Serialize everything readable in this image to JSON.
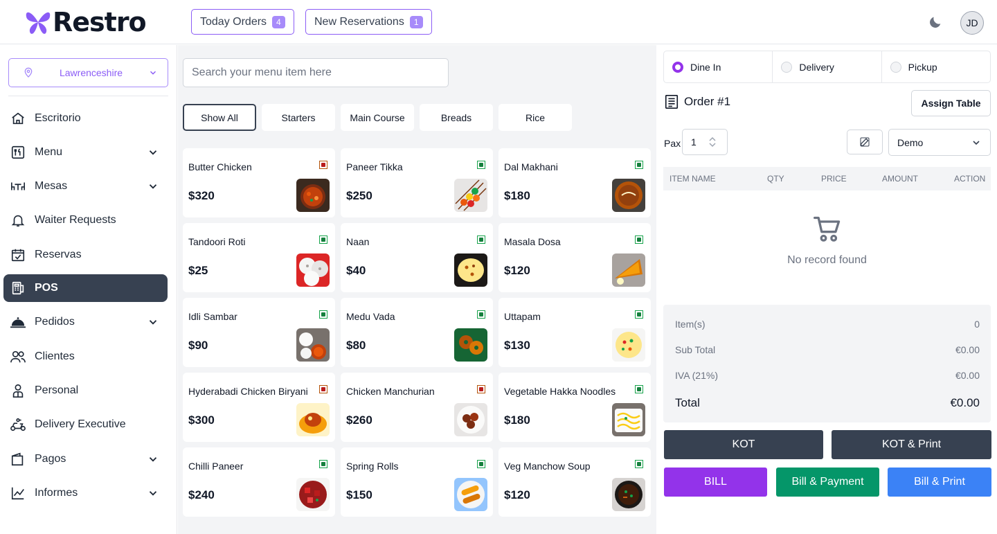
{
  "brand": {
    "name": "Restro",
    "color": "#8b5cf6"
  },
  "header": {
    "today_orders": {
      "label": "Today Orders",
      "count": "4"
    },
    "new_reservations": {
      "label": "New Reservations",
      "count": "1"
    },
    "theme_icon": "moon-icon",
    "avatar_initials": "JD"
  },
  "sidebar": {
    "branch": "Lawrenceshire",
    "items": [
      {
        "label": "Escritorio",
        "icon": "home-icon",
        "expandable": false
      },
      {
        "label": "Menu",
        "icon": "menu-book-icon",
        "expandable": true
      },
      {
        "label": "Mesas",
        "icon": "table-icon",
        "expandable": true
      },
      {
        "label": "Waiter Requests",
        "icon": "bell-icon",
        "expandable": false
      },
      {
        "label": "Reservas",
        "icon": "calendar-check-icon",
        "expandable": false
      },
      {
        "label": "POS",
        "icon": "pos-terminal-icon",
        "expandable": false,
        "active": true
      },
      {
        "label": "Pedidos",
        "icon": "cloche-icon",
        "expandable": true
      },
      {
        "label": "Clientes",
        "icon": "users-icon",
        "expandable": false
      },
      {
        "label": "Personal",
        "icon": "staff-icon",
        "expandable": false
      },
      {
        "label": "Delivery Executive",
        "icon": "scooter-icon",
        "expandable": false
      },
      {
        "label": "Pagos",
        "icon": "wallet-icon",
        "expandable": true
      },
      {
        "label": "Informes",
        "icon": "chart-line-icon",
        "expandable": true
      }
    ]
  },
  "menu": {
    "search_placeholder": "Search your menu item here",
    "categories": [
      "Show All",
      "Starters",
      "Main Course",
      "Breads",
      "Rice"
    ],
    "active_category": "Show All",
    "items": [
      {
        "name": "Butter Chicken",
        "price": "$320",
        "type": "nonveg",
        "img": "curry"
      },
      {
        "name": "Paneer Tikka",
        "price": "$250",
        "type": "veg",
        "img": "skewers"
      },
      {
        "name": "Dal Makhani",
        "price": "$180",
        "type": "veg",
        "img": "dal"
      },
      {
        "name": "Tandoori Roti",
        "price": "$25",
        "type": "veg",
        "img": "roti"
      },
      {
        "name": "Naan",
        "price": "$40",
        "type": "veg",
        "img": "naan"
      },
      {
        "name": "Masala Dosa",
        "price": "$120",
        "type": "veg",
        "img": "dosa"
      },
      {
        "name": "Idli Sambar",
        "price": "$90",
        "type": "veg",
        "img": "idli"
      },
      {
        "name": "Medu Vada",
        "price": "$80",
        "type": "veg",
        "img": "vada"
      },
      {
        "name": "Uttapam",
        "price": "$130",
        "type": "veg",
        "img": "uttapam"
      },
      {
        "name": "Hyderabadi Chicken Biryani",
        "price": "$300",
        "type": "nonveg",
        "img": "biryani"
      },
      {
        "name": "Chicken Manchurian",
        "price": "$260",
        "type": "nonveg",
        "img": "manchurian"
      },
      {
        "name": "Vegetable Hakka Noodles",
        "price": "$180",
        "type": "veg",
        "img": "noodles"
      },
      {
        "name": "Chilli Paneer",
        "price": "$240",
        "type": "veg",
        "img": "chilli"
      },
      {
        "name": "Spring Rolls",
        "price": "$150",
        "type": "veg",
        "img": "rolls"
      },
      {
        "name": "Veg Manchow Soup",
        "price": "$120",
        "type": "veg",
        "img": "soup"
      }
    ]
  },
  "order": {
    "types": [
      {
        "label": "Dine In",
        "selected": true
      },
      {
        "label": "Delivery",
        "selected": false
      },
      {
        "label": "Pickup",
        "selected": false
      }
    ],
    "title": "Order #1",
    "assign_table": "Assign Table",
    "pax_label": "Pax",
    "pax_value": "1",
    "waiter": "Demo",
    "columns": {
      "item": "ITEM NAME",
      "qty": "QTY",
      "price": "PRICE",
      "amount": "AMOUNT",
      "action": "ACTION"
    },
    "empty_text": "No record found",
    "summary": {
      "items_label": "Item(s)",
      "items_value": "0",
      "subtotal_label": "Sub Total",
      "subtotal_value": "€0.00",
      "tax_label": "IVA (21%)",
      "tax_value": "€0.00",
      "total_label": "Total",
      "total_value": "€0.00"
    },
    "actions": {
      "kot": "KOT",
      "kot_print": "KOT & Print",
      "bill": "BILL",
      "bill_payment": "Bill & Payment",
      "bill_print": "Bill & Print"
    },
    "colors": {
      "kot": "#374151",
      "bill": "#9333ea",
      "bill_payment": "#059669",
      "bill_print": "#3b82f6"
    }
  }
}
